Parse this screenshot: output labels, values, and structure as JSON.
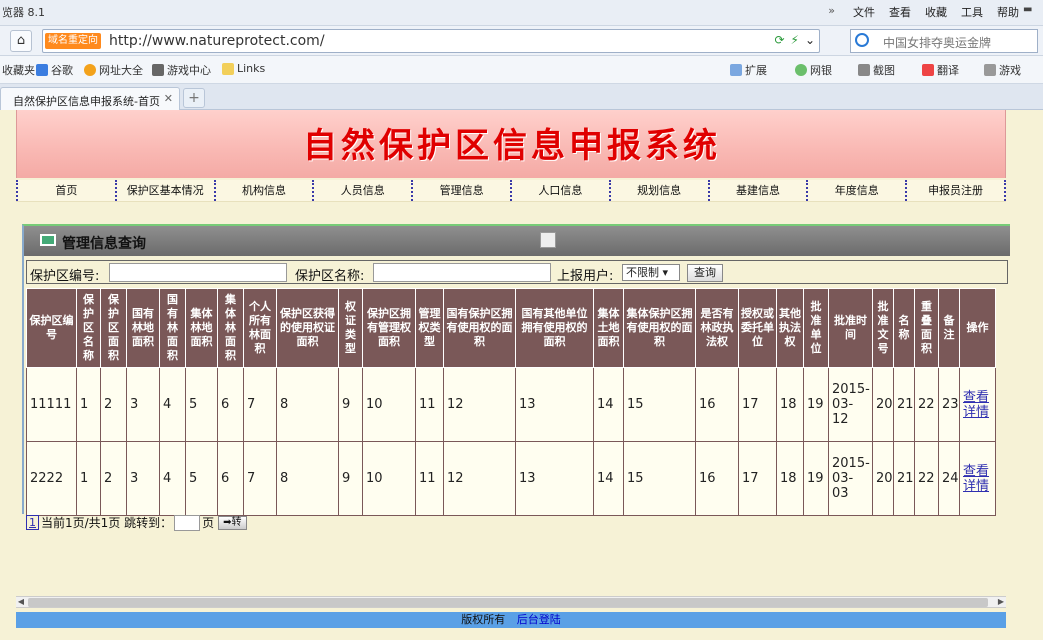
{
  "browser": {
    "app_title": "览器 8.1",
    "menu": [
      "»",
      "文件",
      "查看",
      "收藏",
      "工具",
      "帮助"
    ],
    "redirect_badge": "域名重定向",
    "url": "http://www.natureprotect.com/",
    "search_hint": "中国女排夺奥运金牌",
    "favorites": [
      "收藏夹",
      "谷歌",
      "网址大全",
      "游戏中心",
      "Links"
    ],
    "toolbar_right": [
      "扩展",
      "网银",
      "截图",
      "翻译",
      "游戏"
    ],
    "tab_title": "自然保护区信息申报系统-首页",
    "tab_close": "✕",
    "new_tab": "+"
  },
  "site": {
    "title": "自然保护区信息申报系统",
    "nav": [
      "首页",
      "保护区基本情况",
      "机构信息",
      "人员信息",
      "管理信息",
      "人口信息",
      "规划信息",
      "基建信息",
      "年度信息",
      "申报员注册"
    ]
  },
  "panel": {
    "title": "管理信息查询"
  },
  "search": {
    "code_label": "保护区编号:",
    "name_label": "保护区名称:",
    "user_label": "上报用户:",
    "user_value": "不限制",
    "query_button": "查询"
  },
  "table": {
    "headers": [
      "保护区编号",
      "保护区名称",
      "保护区面积",
      "国有林地面积",
      "国有林面积",
      "集体林地面积",
      "集体林面积",
      "个人所有林面积",
      "保护区获得的使用权证面积",
      "权证类型",
      "保护区拥有管理权面积",
      "管理权类型",
      "国有保护区拥有使用权的面积",
      "国有其他单位拥有使用权的面积",
      "集体土地面积",
      "集体保护区拥有使用权的面积",
      "是否有林政执法权",
      "授权或委托单位",
      "其他执法权",
      "批准单位",
      "批准时间",
      "批准文号",
      "名称",
      "重叠面积",
      "备注",
      "操作"
    ],
    "rows": [
      [
        "11111",
        "1",
        "2",
        "3",
        "4",
        "5",
        "6",
        "7",
        "8",
        "9",
        "10",
        "11",
        "12",
        "13",
        "14",
        "15",
        "16",
        "17",
        "18",
        "19",
        "2015-03-12",
        "20",
        "21",
        "22",
        "23"
      ],
      [
        "2222",
        "1",
        "2",
        "3",
        "4",
        "5",
        "6",
        "7",
        "8",
        "9",
        "10",
        "11",
        "12",
        "13",
        "14",
        "15",
        "16",
        "17",
        "18",
        "19",
        "2015-03-03",
        "20",
        "21",
        "22",
        "24"
      ]
    ],
    "action_label": "查看详情"
  },
  "pager": {
    "page_link": "1",
    "summary": "当前1页/共1页 跳转到：",
    "page_suffix": "页",
    "go_label": "➡转"
  },
  "footer": {
    "copyright": "版权所有",
    "admin_link": "后台登陆"
  }
}
